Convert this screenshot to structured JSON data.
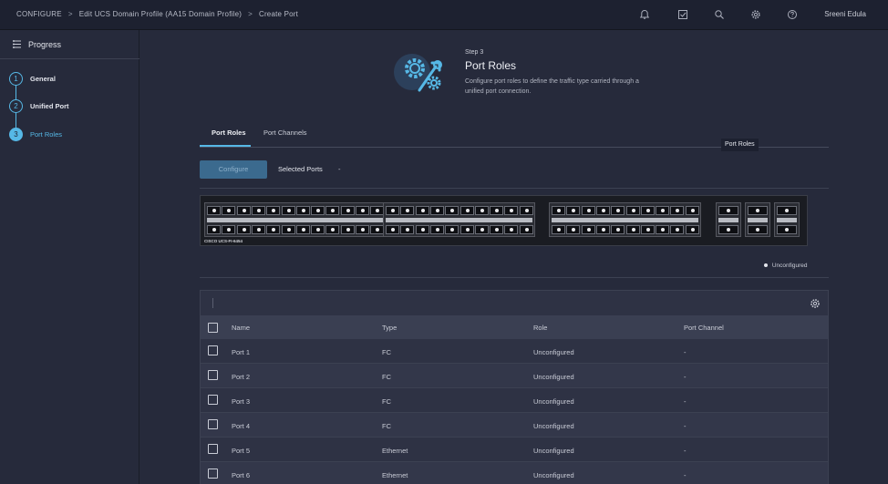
{
  "breadcrumb": {
    "items": [
      "CONFIGURE",
      "Edit UCS Domain Profile (AA15 Domain Profile)",
      "Create Port"
    ],
    "separator": ">"
  },
  "topbar": {
    "icons": [
      "bell-icon",
      "checklist-icon",
      "search-icon",
      "gear-icon",
      "help-icon"
    ],
    "user_name": "Sreeni Edula"
  },
  "sidebar": {
    "title": "Progress",
    "steps": [
      {
        "num": "1",
        "label": "General"
      },
      {
        "num": "2",
        "label": "Unified Port"
      },
      {
        "num": "3",
        "label": "Port Roles"
      }
    ],
    "active_step": 3
  },
  "header": {
    "step": "Step 3",
    "title": "Port Roles",
    "description": "Configure port roles to define the traffic type carried through a unified port connection."
  },
  "tabs": {
    "items": [
      {
        "label": "Port Roles",
        "active": true
      },
      {
        "label": "Port Channels",
        "active": false
      }
    ],
    "tooltip": "Port Roles"
  },
  "toolbar": {
    "configure_label": "Configure",
    "selected_ports_label": "Selected Ports",
    "selected_ports_value": "-"
  },
  "switch": {
    "model_label": "CISCO UCS-FI-6454",
    "legend_label": "Unconfigured"
  },
  "table": {
    "columns": [
      "Name",
      "Type",
      "Role",
      "Port Channel"
    ],
    "rows": [
      {
        "name": "Port 1",
        "type": "FC",
        "role": "Unconfigured",
        "port_channel": "-"
      },
      {
        "name": "Port 2",
        "type": "FC",
        "role": "Unconfigured",
        "port_channel": "-"
      },
      {
        "name": "Port 3",
        "type": "FC",
        "role": "Unconfigured",
        "port_channel": "-"
      },
      {
        "name": "Port 4",
        "type": "FC",
        "role": "Unconfigured",
        "port_channel": "-"
      },
      {
        "name": "Port 5",
        "type": "Ethernet",
        "role": "Unconfigured",
        "port_channel": "-"
      },
      {
        "name": "Port 6",
        "type": "Ethernet",
        "role": "Unconfigured",
        "port_channel": "-"
      }
    ]
  },
  "colors": {
    "accent": "#56b8e6",
    "background": "#262a3b",
    "topbar": "#1d2130",
    "button": "#3b6a8e"
  }
}
